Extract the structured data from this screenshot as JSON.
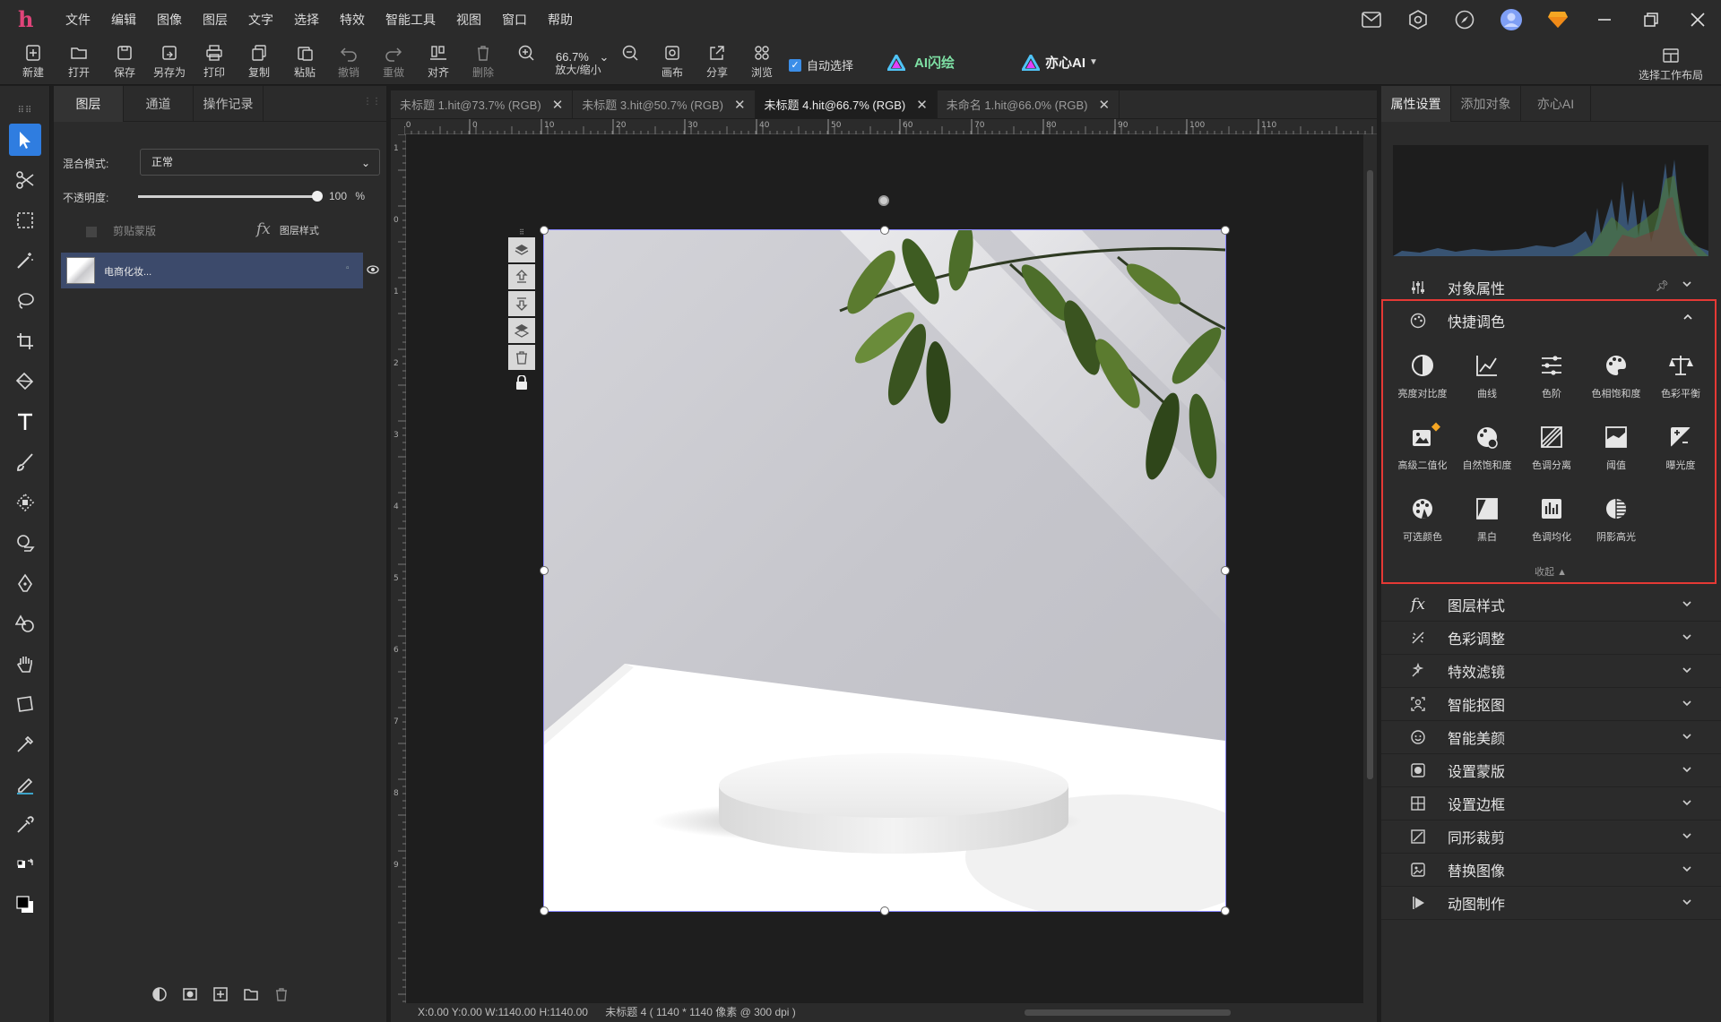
{
  "app": {
    "logo": "h"
  },
  "menu": [
    "文件",
    "编辑",
    "图像",
    "图层",
    "文字",
    "选择",
    "特效",
    "智能工具",
    "视图",
    "窗口",
    "帮助"
  ],
  "toolbar": {
    "new": "新建",
    "open": "打开",
    "save": "保存",
    "save_as": "另存为",
    "print": "打印",
    "copy": "复制",
    "paste": "粘贴",
    "undo": "撤销",
    "redo": "重做",
    "align": "对齐",
    "delete": "删除",
    "zoom_value": "66.7%",
    "zoom_label": "放大/缩小",
    "canvas": "画布",
    "share": "分享",
    "browse": "浏览",
    "auto_select": "自动选择",
    "ai_paint": "AI闪绘",
    "yixin_ai": "亦心AI",
    "workspace": "选择工作布局"
  },
  "layers_panel": {
    "tabs": [
      "图层",
      "通道",
      "操作记录"
    ],
    "blend_label": "混合模式:",
    "blend_value": "正常",
    "opacity_label": "不透明度:",
    "opacity_value": "100",
    "opacity_unit": "%",
    "opacity_fraction": 1.0,
    "clip_mask": "剪贴蒙版",
    "layer_style": "图层样式",
    "layer_name": "电商化妆..."
  },
  "doc_tabs": [
    {
      "title": "未标题 1.hit@73.7% (RGB)",
      "active": false
    },
    {
      "title": "未标题 3.hit@50.7% (RGB)",
      "active": false
    },
    {
      "title": "未标题 4.hit@66.7% (RGB)",
      "active": true
    },
    {
      "title": "未命名 1.hit@66.0% (RGB)",
      "active": false
    }
  ],
  "rulers": {
    "h_ticks": [
      "10",
      "0",
      "10",
      "20",
      "30",
      "40",
      "50",
      "60",
      "70",
      "80",
      "90",
      "100",
      "110"
    ],
    "v_ticks": [
      "1",
      "0",
      "1",
      "2",
      "3",
      "4",
      "5",
      "6",
      "7",
      "8",
      "9"
    ]
  },
  "status": {
    "coords": "X:0.00 Y:0.00 W:1140.00 H:1140.00",
    "doc_info": "未标题 4 ( 1140 * 1140 像素 @ 300 dpi )"
  },
  "right_panel": {
    "tabs": [
      "属性设置",
      "添加对象",
      "亦心AI"
    ],
    "object_props": "对象属性",
    "quick_tone": "快捷调色",
    "quick_items": [
      {
        "label": "亮度对比度",
        "icon": "contrast-icon"
      },
      {
        "label": "曲线",
        "icon": "curve-icon"
      },
      {
        "label": "色阶",
        "icon": "levels-icon"
      },
      {
        "label": "色相饱和度",
        "icon": "palette-icon"
      },
      {
        "label": "色彩平衡",
        "icon": "balance-icon"
      },
      {
        "label": "高级二值化",
        "icon": "binarize-icon"
      },
      {
        "label": "自然饱和度",
        "icon": "vibrance-icon"
      },
      {
        "label": "色调分离",
        "icon": "posterize-icon"
      },
      {
        "label": "阈值",
        "icon": "threshold-icon"
      },
      {
        "label": "曝光度",
        "icon": "exposure-icon"
      },
      {
        "label": "可选颜色",
        "icon": "selective-color-icon"
      },
      {
        "label": "黑白",
        "icon": "black-white-icon"
      },
      {
        "label": "色调均化",
        "icon": "equalize-icon"
      },
      {
        "label": "阴影高光",
        "icon": "shadow-highlight-icon"
      }
    ],
    "collapse": "收起 ▲",
    "sections": [
      {
        "label": "图层样式",
        "icon": "fx-icon"
      },
      {
        "label": "色彩调整",
        "icon": "color-adjust-icon"
      },
      {
        "label": "特效滤镜",
        "icon": "filter-icon"
      },
      {
        "label": "智能抠图",
        "icon": "cutout-icon"
      },
      {
        "label": "智能美颜",
        "icon": "beauty-icon"
      },
      {
        "label": "设置蒙版",
        "icon": "mask-icon"
      },
      {
        "label": "设置边框",
        "icon": "border-icon"
      },
      {
        "label": "同形裁剪",
        "icon": "crop-shape-icon"
      },
      {
        "label": "替换图像",
        "icon": "replace-image-icon"
      },
      {
        "label": "动图制作",
        "icon": "animation-icon"
      }
    ]
  },
  "colors": {
    "accent": "#2f7de0",
    "selected_layer": "#3c4a6b",
    "highlight_border": "#e53935",
    "vip": "#f5a623"
  }
}
